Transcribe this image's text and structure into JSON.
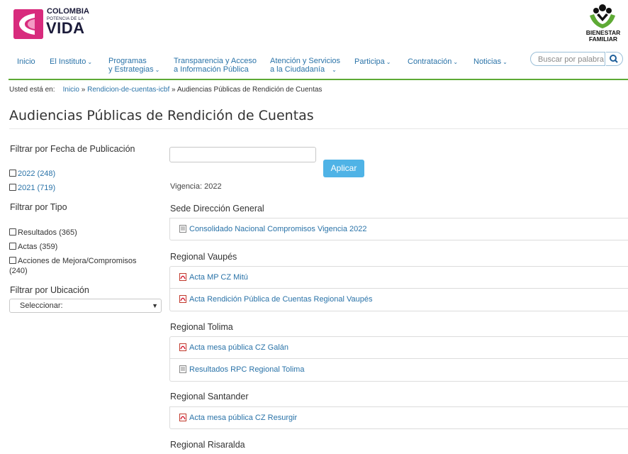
{
  "header": {
    "logo_line1": "COLOMBIA",
    "logo_line2": "POTENCIA DE LA",
    "logo_line3": "VIDA",
    "brand_line1": "BIENESTAR",
    "brand_line2": "FAMILIAR"
  },
  "nav": {
    "items": [
      {
        "label": "Inicio"
      },
      {
        "label": "El Instituto"
      },
      {
        "label_l1": "Programas",
        "label_l2": "y Estrategias"
      },
      {
        "label_l1": "Transparencia y Acceso",
        "label_l2": "a Información Pública"
      },
      {
        "label_l1": "Atención y Servicios",
        "label_l2": "a la Ciudadanía"
      },
      {
        "label": "Participa"
      },
      {
        "label": "Contratación"
      },
      {
        "label": "Noticias"
      }
    ],
    "search_placeholder": "Buscar por palabra"
  },
  "breadcrumb": {
    "prefix": "Usted está en:",
    "home": "Inicio",
    "sep": "»",
    "section": "Rendicion-de-cuentas-icbf",
    "current": "Audiencias Públicas de Rendición de Cuentas"
  },
  "page_title": "Audiencias Públicas de Rendición de Cuentas",
  "sidebar": {
    "date_filter_title": "Filtrar por Fecha de Publicación",
    "date_options": [
      "2022 (248)",
      "2021 (719)"
    ],
    "type_filter_title": "Filtrar por Tipo",
    "type_options": [
      "Resultados (365)",
      "Actas (359)",
      "Acciones de Mejora/Compromisos",
      "(240)"
    ],
    "location_filter_title": "Filtrar por Ubicación",
    "location_selected": "Seleccionar:"
  },
  "main": {
    "apply_label": "Aplicar",
    "vigencia": "Vigencia: 2022",
    "groups": [
      {
        "title": "Sede Dirección General",
        "docs": [
          {
            "label": "Consolidado Nacional Compromisos Vigencia 2022",
            "icon": "doc-icon"
          }
        ]
      },
      {
        "title": "Regional Vaupés",
        "docs": [
          {
            "label": "Acta MP CZ Mitú",
            "icon": "pdf-icon"
          },
          {
            "label": "Acta Rendición Pública de Cuentas Regional Vaupés",
            "icon": "pdf-icon"
          }
        ]
      },
      {
        "title": "Regional Tolima",
        "docs": [
          {
            "label": "Acta mesa pública CZ Galán",
            "icon": "pdf-icon"
          },
          {
            "label": "Resultados RPC Regional Tolima",
            "icon": "doc-icon"
          }
        ]
      },
      {
        "title": "Regional Santander",
        "docs": [
          {
            "label": "Acta mesa pública CZ Resurgir",
            "icon": "pdf-icon"
          }
        ]
      },
      {
        "title": "Regional Risaralda",
        "docs": []
      }
    ]
  },
  "colors": {
    "link": "#2a73a8",
    "accent_green": "#5eaa35",
    "button": "#4fb3e6",
    "logo_pink": "#d82b7d"
  }
}
